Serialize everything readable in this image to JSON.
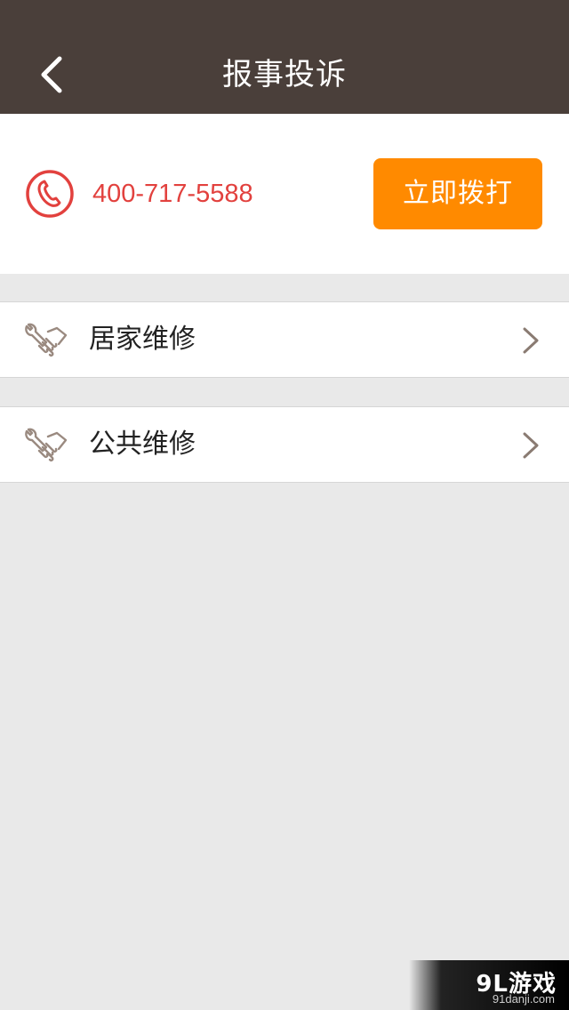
{
  "header": {
    "title": "报事投诉",
    "back_icon": "back-chevron-icon"
  },
  "phone": {
    "number": "400-717-5588",
    "call_label": "立即拨打",
    "icon": "phone-icon",
    "number_color": "#e2413e",
    "button_color": "#ff8a00"
  },
  "menu": {
    "items": [
      {
        "label": "居家维修",
        "icon": "repair-handshake-icon"
      },
      {
        "label": "公共维修",
        "icon": "repair-handshake-icon"
      }
    ]
  },
  "watermark": {
    "logo": "9L游戏",
    "url": "91danji.com"
  },
  "colors": {
    "header_bg": "#4a3f3a",
    "page_bg": "#e9e9e9"
  }
}
